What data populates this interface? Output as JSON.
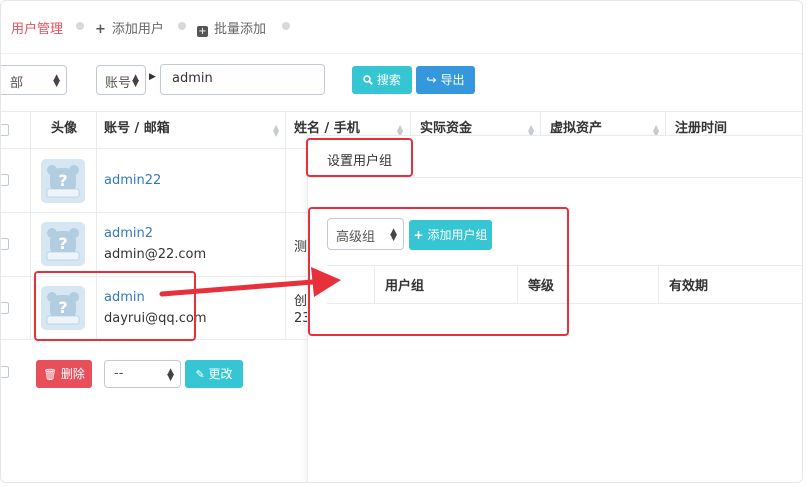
{
  "tabs": {
    "user_manage": "用户管理",
    "add_user": "添加用户",
    "batch_add": "批量添加"
  },
  "filter": {
    "scope_value": "部",
    "field_value": "账号",
    "search_value": "admin",
    "search_label": "搜索",
    "export_label": "导出"
  },
  "table": {
    "headers": {
      "avatar": "头像",
      "account": "账号 / 邮箱",
      "name": "姓名 / 手机",
      "funds": "实际资金",
      "virtual": "虚拟资产",
      "reg_time": "注册时间"
    },
    "rows": [
      {
        "account": "admin22",
        "email": "",
        "name": "",
        "phone": ""
      },
      {
        "account": "admin2",
        "email": "admin@22.com",
        "name": "测",
        "phone": ""
      },
      {
        "account": "admin",
        "email": "dayrui@qq.com",
        "name": "创",
        "phone": "23"
      }
    ]
  },
  "footer": {
    "delete_label": "删除",
    "select_value": "--",
    "change_label": "更改"
  },
  "panel": {
    "title": "设置用户组",
    "group_select_value": "高级组",
    "add_group_label": "添加用户组",
    "columns": {
      "group": "用户组",
      "level": "等级",
      "expiry": "有效期"
    }
  },
  "colors": {
    "accent_red": "#e7505a",
    "annotation_red": "#e8303d",
    "teal": "#36c6d3",
    "blue": "#3598dc",
    "link": "#337ab7"
  }
}
